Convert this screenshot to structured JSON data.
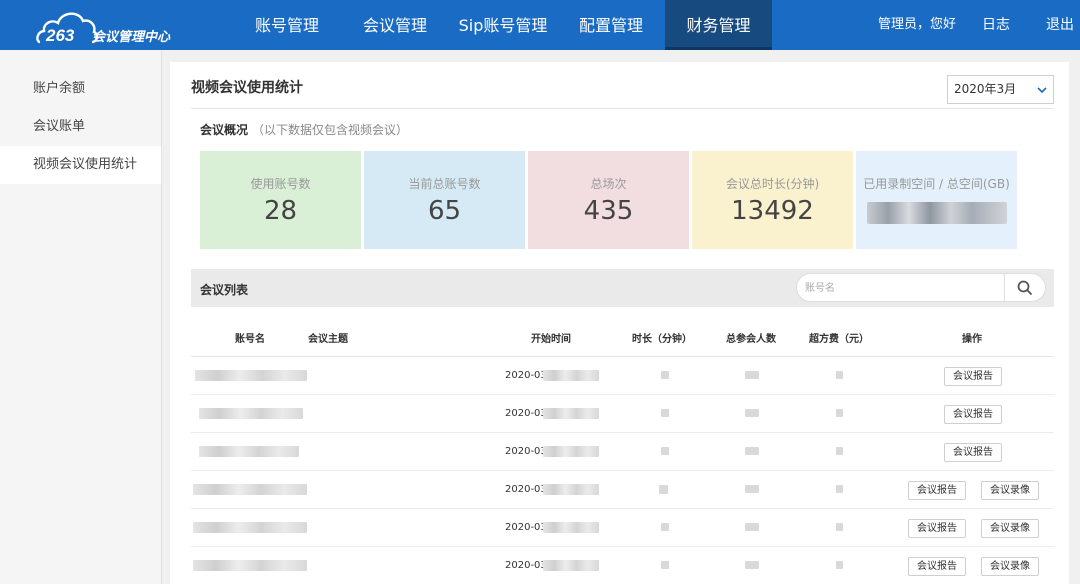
{
  "header": {
    "logo_text": "会议管理中心",
    "nav": [
      "账号管理",
      "会议管理",
      "Sip账号管理",
      "配置管理",
      "财务管理"
    ],
    "greeting": "管理员，您好",
    "log": "日志",
    "logout": "退出"
  },
  "sidebar": {
    "items": [
      {
        "label": "账户余额"
      },
      {
        "label": "会议账单"
      },
      {
        "label": "视频会议使用统计"
      }
    ],
    "active_index": 2
  },
  "page": {
    "title": "视频会议使用统计",
    "month_value": "2020年3月",
    "overview_title": "会议概况",
    "overview_note": "（以下数据仅包含视频会议）"
  },
  "cards": [
    {
      "label": "使用账号数",
      "value": "28",
      "color": "#d9efd6"
    },
    {
      "label": "当前总账号数",
      "value": "65",
      "color": "#d6eaf5"
    },
    {
      "label": "总场次",
      "value": "435",
      "color": "#f2dde0"
    },
    {
      "label": "会议总时长(分钟)",
      "value": "13492",
      "color": "#faf1cf"
    },
    {
      "label": "已用录制空间 / 总空间(GB)",
      "value": "",
      "color": "#e4f1fc"
    }
  ],
  "list": {
    "title": "会议列表",
    "search_placeholder": "账号名",
    "columns": [
      "账号名",
      "会议主题",
      "开始时间",
      "时长（分钟）",
      "总参会人数",
      "超方费（元）",
      "操作"
    ],
    "rows": [
      {
        "start_prefix": "2020-03-",
        "actions": [
          "会议报告"
        ]
      },
      {
        "start_prefix": "2020-03-",
        "actions": [
          "会议报告"
        ]
      },
      {
        "start_prefix": "2020-03-",
        "actions": [
          "会议报告"
        ]
      },
      {
        "start_prefix": "2020-03-",
        "actions": [
          "会议报告",
          "会议录像"
        ]
      },
      {
        "start_prefix": "2020-03",
        "actions": [
          "会议报告",
          "会议录像"
        ]
      },
      {
        "start_prefix": "2020-03-",
        "actions": [
          "会议报告",
          "会议录像"
        ]
      }
    ]
  },
  "colors": {
    "header_bg": "#1a6bc4",
    "nav_active_bg": "#174a7e",
    "search_icon": "#555555"
  },
  "icons": {
    "logo": "cloud-logo-icon",
    "month_dropdown": "chevron-down-icon",
    "search": "search-icon"
  }
}
